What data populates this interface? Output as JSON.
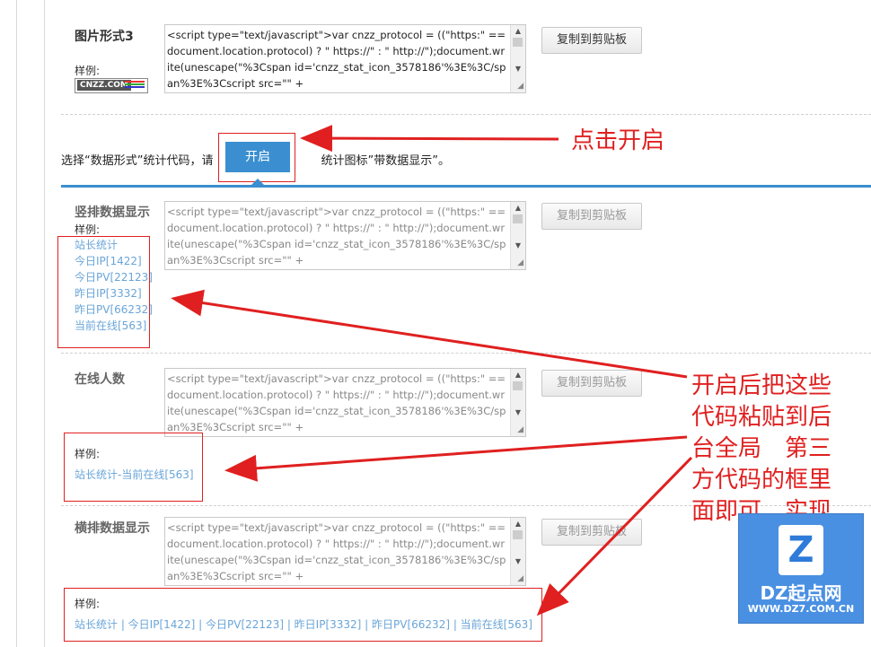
{
  "code_snippet": "<script type=\"text/javascript\">var cnzz_protocol = ((\"https:\" == document.location.protocol) ? \" https://\" : \" http://\");document.write(unescape(\"%3Cspan id='cnzz_stat_icon_3578186'%3E%3C/span%3E%3Cscript src=\"\" +",
  "copy_button_label": "复制到剪贴板",
  "sample_label": "样例:",
  "section_image3": {
    "title": "图片形式3",
    "badge_text": "CNZZ.COM"
  },
  "instruction": {
    "text_before": "选择“数据形式”统计代码，请",
    "text_after": "统计图标”带数据显示”。",
    "open_button": "开启"
  },
  "section_vertical": {
    "title": "竖排数据显示",
    "items": [
      "站长统计",
      "今日IP[1422]",
      "今日PV[22123]",
      "昨日IP[3332]",
      "昨日PV[66232]",
      "当前在线[563]"
    ]
  },
  "section_online": {
    "title": "在线人数",
    "sample_text": "站长统计-当前在线[563]"
  },
  "section_horizontal": {
    "title": "横排数据显示",
    "sample_text": "站长统计 | 今日IP[1422] | 今日PV[22123] | 昨日IP[3332] | 昨日PV[66232] | 当前在线[563]"
  },
  "annotations": {
    "click_open": "点击开启",
    "lines": [
      "开启后把这些",
      "代码粘贴到后",
      "台全局　第三",
      "方代码的框里",
      "面即可　实现"
    ]
  },
  "watermark": {
    "logo_letter": "Z",
    "name": "DZ起点网",
    "url": "WWW.DZ7.COM.CN"
  },
  "colors": {
    "accent": "#3b8fd0",
    "annotation": "#e02020",
    "link": "#6aa5d8"
  }
}
